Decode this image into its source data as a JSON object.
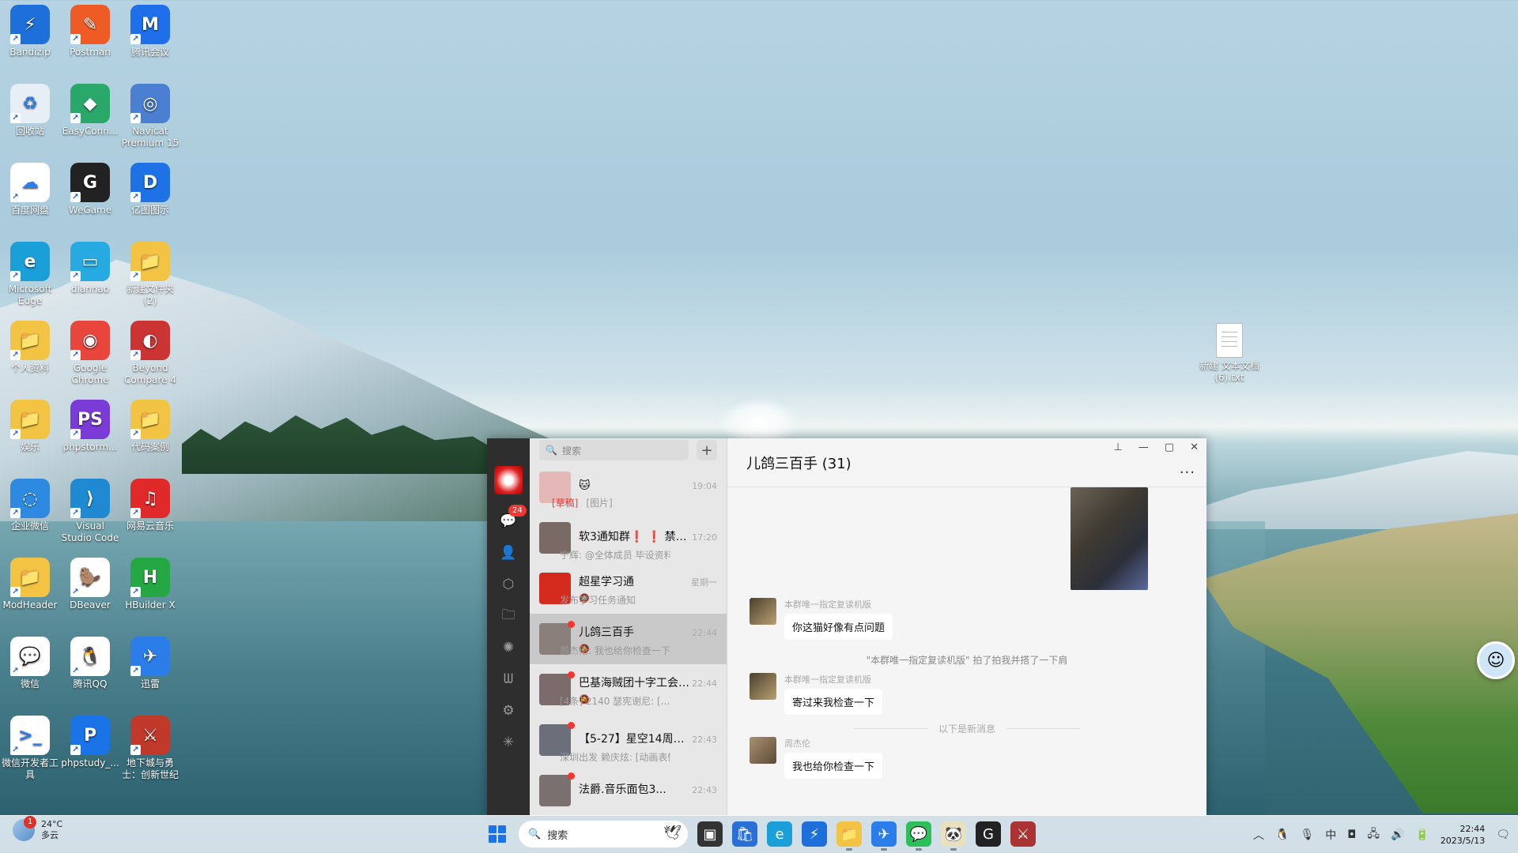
{
  "desktop": {
    "icons": [
      {
        "label": "Bandizip",
        "glyph": "⚡",
        "color": "#1e6fd9"
      },
      {
        "label": "Postman",
        "glyph": "✎",
        "color": "#ef5b25"
      },
      {
        "label": "腾讯会议",
        "glyph": "M",
        "color": "#1f6feb"
      },
      {
        "label": "回收站",
        "glyph": "♻",
        "color": "#e8eef5"
      },
      {
        "label": "EasyConn...",
        "glyph": "◆",
        "color": "#2aa86a"
      },
      {
        "label": "Navicat Premium 15",
        "glyph": "◎",
        "color": "#4a7fd1"
      },
      {
        "label": "百度网盘",
        "glyph": "☁",
        "color": "#ffffff"
      },
      {
        "label": "WeGame",
        "glyph": "G",
        "color": "#222222"
      },
      {
        "label": "亿图图示",
        "glyph": "D",
        "color": "#1e72e6"
      },
      {
        "label": "Microsoft Edge",
        "glyph": "e",
        "color": "#1a9fd9"
      },
      {
        "label": "diannao",
        "glyph": "▭",
        "color": "#27a9e1"
      },
      {
        "label": "新建文件夹 (2)",
        "glyph": "📁",
        "color": "#f3c343"
      },
      {
        "label": "个人资料",
        "glyph": "📁",
        "color": "#f3c343"
      },
      {
        "label": "Google Chrome",
        "glyph": "◉",
        "color": "#e8453c"
      },
      {
        "label": "Beyond Compare 4",
        "glyph": "◐",
        "color": "#cc3333"
      },
      {
        "label": "娱乐",
        "glyph": "📁",
        "color": "#f3c343"
      },
      {
        "label": "phpstorm...",
        "glyph": "PS",
        "color": "#7b3bd6"
      },
      {
        "label": "代码案例",
        "glyph": "📁",
        "color": "#f3c343"
      },
      {
        "label": "企业微信",
        "glyph": "◌",
        "color": "#2d8ae0"
      },
      {
        "label": "Visual Studio Code",
        "glyph": "⟩",
        "color": "#1f8ad2"
      },
      {
        "label": "网易云音乐",
        "glyph": "♫",
        "color": "#e02a2a"
      },
      {
        "label": "ModHeader",
        "glyph": "📁",
        "color": "#f3c343"
      },
      {
        "label": "DBeaver",
        "glyph": "🦫",
        "color": "#ffffff"
      },
      {
        "label": "HBuilder X",
        "glyph": "H",
        "color": "#25a843"
      },
      {
        "label": "微信",
        "glyph": "💬",
        "color": "#ffffff"
      },
      {
        "label": "腾讯QQ",
        "glyph": "🐧",
        "color": "#ffffff"
      },
      {
        "label": "迅雷",
        "glyph": "✈",
        "color": "#2b7de9"
      },
      {
        "label": "微信开发者工具",
        "glyph": ">_",
        "color": "#ffffff"
      },
      {
        "label": "phpstudy_...",
        "glyph": "P",
        "color": "#1a74e8"
      },
      {
        "label": "地下城与勇士：创新世纪",
        "glyph": "⚔",
        "color": "#c0392b"
      }
    ],
    "file_icon": {
      "label": "新建 文本文档 (6).txt"
    }
  },
  "wechat": {
    "nav": {
      "chat_badge": "24"
    },
    "search": {
      "placeholder": "搜索",
      "plus": "+"
    },
    "conversations": [
      {
        "name": "🐱",
        "time": "19:04",
        "prefix": "[草稿]",
        "message": "[图片]",
        "muted": false,
        "unread": false,
        "avatar": "#e5b8b8"
      },
      {
        "name": "软3通知群❗ ❗ 禁口...",
        "time": "17:20",
        "prefix": "",
        "message": "宁辉: @全体成员 毕设资料...",
        "muted": false,
        "unread": false,
        "avatar": "#7a6a66"
      },
      {
        "name": "超星学习通",
        "time": "星期一",
        "prefix": "",
        "message": "发布学习任务通知",
        "muted": true,
        "unread": false,
        "avatar": "#d42b1e"
      },
      {
        "name": "儿鸽三百手",
        "time": "22:44",
        "prefix": "",
        "message": "周杰伦: 我也给你检查一下",
        "muted": true,
        "unread": true,
        "avatar": "#8a7f7a"
      },
      {
        "name": "巴基海贼团十字工会(...",
        "time": "22:44",
        "prefix": "",
        "message": "[4条] 2140  瑟宪谢尼: [...",
        "muted": true,
        "unread": true,
        "avatar": "#7c6b6b"
      },
      {
        "name": "【5-27】星空14周年...",
        "time": "22:43",
        "prefix": "",
        "message": "深圳出发 赖庆炫: [动画表情]",
        "muted": false,
        "unread": true,
        "avatar": "#6a6f7a"
      },
      {
        "name": "法爵.音乐面包3...",
        "time": "22:43",
        "prefix": "",
        "message": "",
        "muted": false,
        "unread": true,
        "avatar": "#7a7070"
      }
    ],
    "chat": {
      "title": "儿鸽三百手 (31)",
      "controls": {
        "pin": "⊥",
        "min": "—",
        "max": "▢",
        "close": "✕"
      },
      "more": "...",
      "messages": [
        {
          "sender": "本群唯一指定复读机版",
          "text": "你这猫好像有点问题"
        },
        {
          "system": "\"本群唯一指定复读机版\" 拍了拍我并搭了一下肩"
        },
        {
          "sender": "本群唯一指定复读机版",
          "text": "寄过来我检查一下"
        },
        {
          "divider": "以下是新消息"
        },
        {
          "sender": "周杰伦",
          "text": "我也给你检查一下"
        }
      ]
    }
  },
  "taskbar": {
    "weather": {
      "temp": "24°C",
      "desc": "多云",
      "badge": "1"
    },
    "search_placeholder": "搜索",
    "apps": [
      {
        "name": "task-view-icon",
        "glyph": "▣",
        "color": "#333333",
        "run": false
      },
      {
        "name": "store-icon",
        "glyph": "🛍",
        "color": "#2a6fd6",
        "run": false
      },
      {
        "name": "edge-icon",
        "glyph": "e",
        "color": "#1a9fd9",
        "run": false
      },
      {
        "name": "bandizip-icon",
        "glyph": "⚡",
        "color": "#1e6fd9",
        "run": false
      },
      {
        "name": "file-explorer-icon",
        "glyph": "📁",
        "color": "#f3c343",
        "run": true
      },
      {
        "name": "xunlei-icon",
        "glyph": "✈",
        "color": "#2b7de9",
        "run": true
      },
      {
        "name": "wechat-icon",
        "glyph": "💬",
        "color": "#2dc05a",
        "run": true
      },
      {
        "name": "qq-icon",
        "glyph": "🐼",
        "color": "#e9e0c0",
        "run": true
      },
      {
        "name": "wegame-icon",
        "glyph": "G",
        "color": "#222222",
        "run": false
      },
      {
        "name": "dnf-icon",
        "glyph": "⚔",
        "color": "#a33",
        "run": false
      }
    ],
    "clock": {
      "time": "22:44",
      "date": "2023/5/13"
    },
    "ime": "中"
  }
}
